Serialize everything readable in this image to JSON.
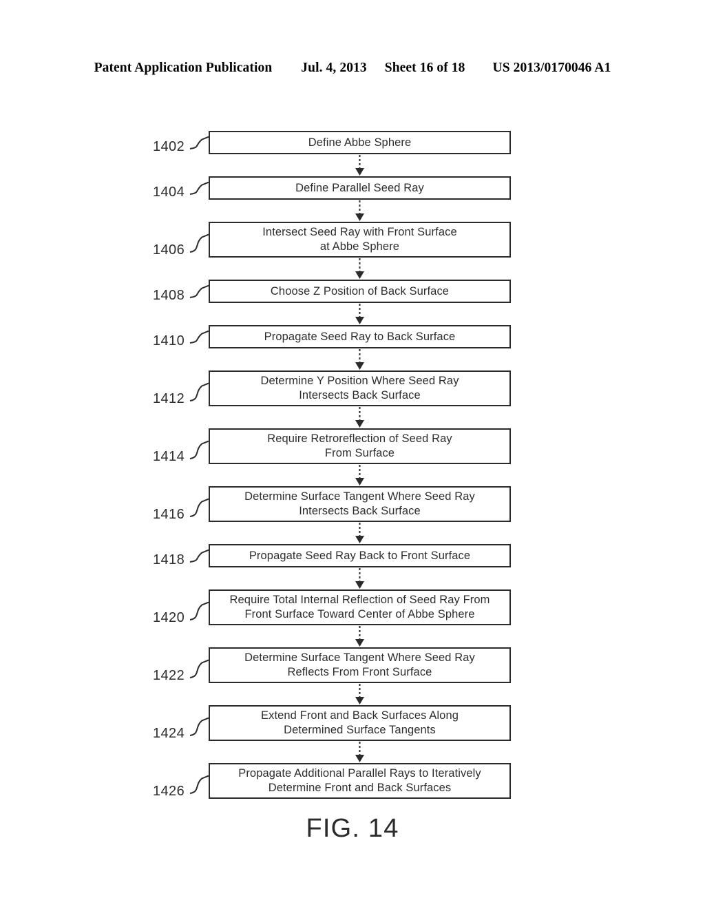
{
  "header": {
    "publication": "Patent Application Publication",
    "date": "Jul. 4, 2013",
    "sheet": "Sheet 16 of 18",
    "number": "US 2013/0170046 A1"
  },
  "figure": {
    "caption": "FIG. 14",
    "colors": {
      "line": "#2b2b2b",
      "text": "#2e2e2e",
      "background": "#ffffff"
    },
    "steps": [
      {
        "ref": "1402",
        "label": "Define Abbe Sphere",
        "lines": 1
      },
      {
        "ref": "1404",
        "label": "Define Parallel Seed Ray",
        "lines": 1
      },
      {
        "ref": "1406",
        "label": "Intersect Seed Ray with Front Surface\nat Abbe Sphere",
        "lines": 2
      },
      {
        "ref": "1408",
        "label": "Choose Z Position of Back Surface",
        "lines": 1
      },
      {
        "ref": "1410",
        "label": "Propagate Seed Ray to Back Surface",
        "lines": 1
      },
      {
        "ref": "1412",
        "label": "Determine Y Position Where Seed Ray\nIntersects Back Surface",
        "lines": 2
      },
      {
        "ref": "1414",
        "label": "Require Retroreflection of Seed Ray\nFrom Surface",
        "lines": 2
      },
      {
        "ref": "1416",
        "label": "Determine Surface Tangent Where Seed Ray\nIntersects Back Surface",
        "lines": 2
      },
      {
        "ref": "1418",
        "label": "Propagate Seed Ray Back to Front Surface",
        "lines": 1
      },
      {
        "ref": "1420",
        "label": "Require Total Internal Reflection of Seed Ray From\nFront Surface Toward Center of Abbe Sphere",
        "lines": 2
      },
      {
        "ref": "1422",
        "label": "Determine Surface Tangent Where Seed Ray\nReflects From Front Surface",
        "lines": 2
      },
      {
        "ref": "1424",
        "label": "Extend Front and Back Surfaces Along\nDetermined Surface Tangents",
        "lines": 2
      },
      {
        "ref": "1426",
        "label": "Propagate Additional Parallel Rays to Iteratively\nDetermine Front and Back Surfaces",
        "lines": 2
      }
    ]
  }
}
